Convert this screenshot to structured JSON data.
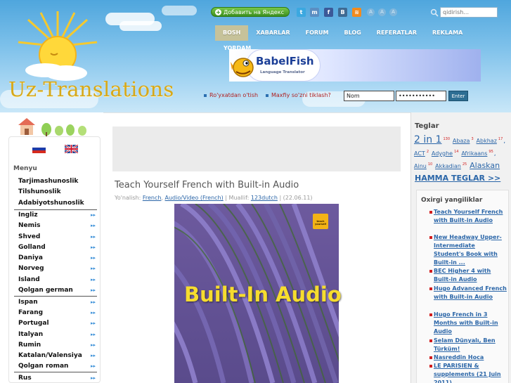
{
  "header": {
    "site_name": "Uz-Translations",
    "yandex_button": "Добавить на Яндекс",
    "search_placeholder": "qidirish...",
    "font_size_labels": [
      "A",
      "A",
      "A"
    ],
    "nav": [
      "BOSH",
      "XABARLAR",
      "FORUM",
      "BLOG",
      "REFERATLAR",
      "REKLAMA"
    ],
    "nav_second_row": "YORDAM",
    "banner": {
      "title": "BabelFish",
      "subtitle": "Language Translator"
    },
    "auth": {
      "register": "Ro'yxatdan o'tish",
      "forgot_password": "Maxfiy so'zni tiklash?",
      "username_value": "Nom",
      "password_value": "•••••••••••",
      "enter": "Enter"
    }
  },
  "sidebar": {
    "menu_title": "Menyu",
    "sections": [
      "Tarjimashunoslik",
      "Tilshunoslik",
      "Adabiyotshunoslik"
    ],
    "languages_group1": [
      "Ingliz",
      "Nemis",
      "Shved",
      "Golland",
      "Daniya",
      "Norveg",
      "Island",
      "Qolgan german"
    ],
    "languages_group2": [
      "Ispan",
      "Farang",
      "Portugal",
      "Italyan",
      "Rumin",
      "Katalan/Valensiya",
      "Qolgan roman"
    ],
    "languages_group3": [
      "Rus"
    ]
  },
  "post": {
    "title": "Teach Yourself French with Built-in Audio",
    "meta_prefix": "Yo'nalish:",
    "category1": "French",
    "category2": "Audio/Video (French)",
    "author_prefix": "| Muallif:",
    "author": "123dutch",
    "date": "| (22.06.11)",
    "cover_text": "Built-In Audio",
    "cover_logo": "teach yourself"
  },
  "right": {
    "tags_title": "Teglar",
    "tags": [
      {
        "name": "2 in 1",
        "count": "130"
      },
      {
        "name": "Abaza",
        "count": "3"
      },
      {
        "name": "Abkhaz",
        "count": "17"
      },
      {
        "name": "ACT",
        "count": "2"
      },
      {
        "name": "Adyghe",
        "count": "14"
      },
      {
        "name": "Afrikaans",
        "count": "95"
      },
      {
        "name": "Ainu",
        "count": "10"
      },
      {
        "name": "Akkadian",
        "count": "25"
      },
      {
        "name": "Alaskan",
        "count": ""
      }
    ],
    "all_tags": "HAMMA TEGLAR >>",
    "news_title": "Oxirgi yangiliklar",
    "news": [
      "Teach Yourself French with Built-in Audio",
      "New Headway Upper-Intermediate Student's Book with Built-in ...",
      "BEC Higher 4 with Built-in Audio",
      "Hugo Advanced French with Built-in Audio",
      "Hugo French in 3 Months with Built-in Audio",
      "Selam Dünyalı, Ben Türküm!",
      "Nasreddin Hoca",
      "LE PARISIEN & supplements (21 Juin 2011)"
    ]
  },
  "colors": {
    "accent_blue": "#2b66a8",
    "logo_gold": "#d6a81a",
    "link_red": "#b01e1e"
  }
}
